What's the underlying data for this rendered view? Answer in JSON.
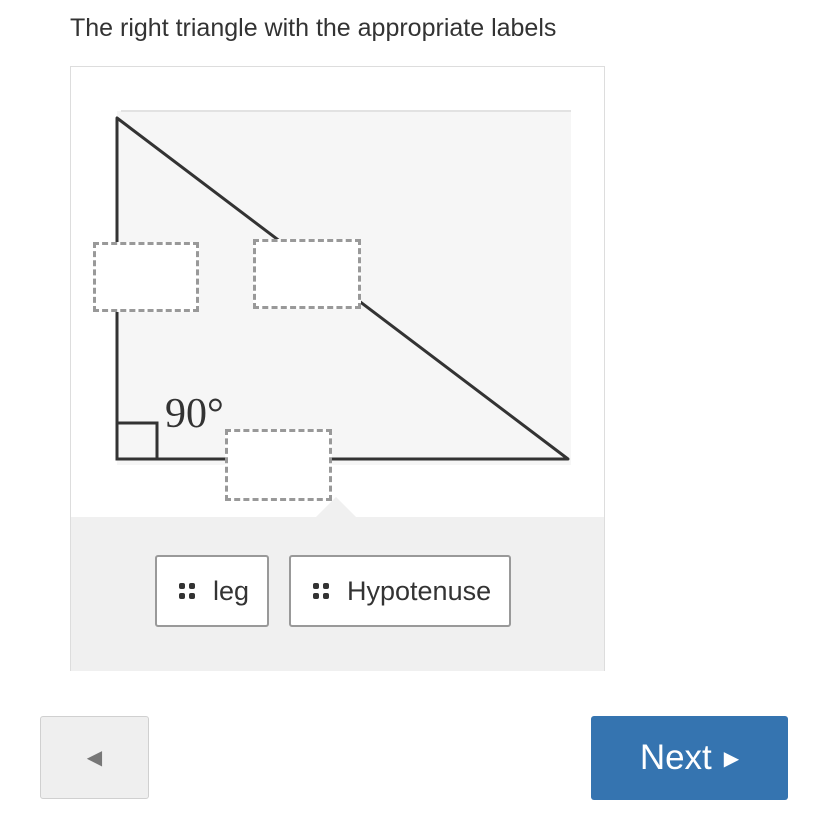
{
  "question": {
    "prompt": "The right triangle with the appropriate labels"
  },
  "figure": {
    "angle_label": "90°"
  },
  "drop_zones": [
    {
      "name": "left-leg"
    },
    {
      "name": "hypotenuse"
    },
    {
      "name": "bottom-leg"
    }
  ],
  "tokens": [
    {
      "label": "leg",
      "icon": "drag-handle-icon"
    },
    {
      "label": "Hypotenuse",
      "icon": "drag-handle-icon"
    }
  ],
  "navigation": {
    "prev_symbol": "◀",
    "next_label": "Next",
    "next_symbol": "▶"
  },
  "colors": {
    "next_button": "#3574b0",
    "drop_zone_border": "#999999",
    "tray_background": "#f0f0f0"
  }
}
